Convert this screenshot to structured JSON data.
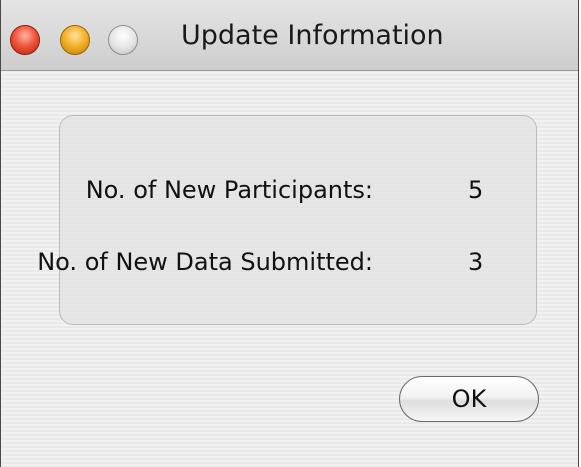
{
  "window": {
    "title": "Update Information"
  },
  "summary": {
    "new_participants_label": "No. of New Participants:",
    "new_participants_value": "5",
    "new_data_label": "No. of New Data Submitted:",
    "new_data_value": "3"
  },
  "buttons": {
    "ok_label": "OK"
  },
  "icons": {
    "close": "close-icon",
    "minimize": "minimize-icon",
    "zoom": "zoom-icon"
  },
  "colors": {
    "close": "#f0573e",
    "minimize": "#f4b12a",
    "zoom": "#e6e6e6"
  }
}
